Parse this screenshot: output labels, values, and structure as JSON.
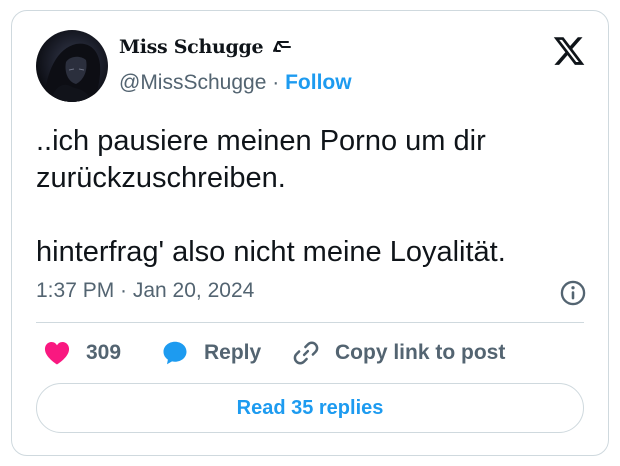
{
  "author": {
    "display_name": "Miss Schugge",
    "handle": "@MissSchugge",
    "separator": "·",
    "follow_label": "Follow"
  },
  "tweet": {
    "lines": [
      "..ich pausiere meinen Porno um dir zurückzuschreiben.",
      "hinterfrag' also nicht meine Loyalität."
    ],
    "timestamp": "1:37 PM · Jan 20, 2024"
  },
  "actions": {
    "like_count": "309",
    "reply_label": "Reply",
    "copy_label": "Copy link to post"
  },
  "footer": {
    "read_replies_label": "Read 35 replies"
  },
  "colors": {
    "accent": "#1d9bf0",
    "like": "#f91880",
    "text": "#0f1419",
    "muted": "#536471",
    "border": "#cfd9de"
  },
  "icons": {
    "logo": "x-logo-icon",
    "info": "info-icon",
    "like": "heart-icon",
    "reply": "speech-bubble-icon",
    "copy": "link-icon",
    "name_emblem": "hand-emblem-icon"
  }
}
